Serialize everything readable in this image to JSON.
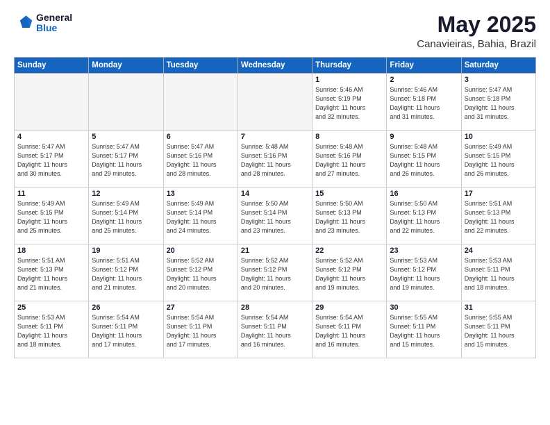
{
  "logo": {
    "general": "General",
    "blue": "Blue"
  },
  "header": {
    "month_year": "May 2025",
    "location": "Canavieiras, Bahia, Brazil"
  },
  "weekdays": [
    "Sunday",
    "Monday",
    "Tuesday",
    "Wednesday",
    "Thursday",
    "Friday",
    "Saturday"
  ],
  "weeks": [
    [
      {
        "day": "",
        "empty": true,
        "content": ""
      },
      {
        "day": "",
        "empty": true,
        "content": ""
      },
      {
        "day": "",
        "empty": true,
        "content": ""
      },
      {
        "day": "",
        "empty": true,
        "content": ""
      },
      {
        "day": "1",
        "empty": false,
        "content": "Sunrise: 5:46 AM\nSunset: 5:19 PM\nDaylight: 11 hours\nand 32 minutes."
      },
      {
        "day": "2",
        "empty": false,
        "content": "Sunrise: 5:46 AM\nSunset: 5:18 PM\nDaylight: 11 hours\nand 31 minutes."
      },
      {
        "day": "3",
        "empty": false,
        "content": "Sunrise: 5:47 AM\nSunset: 5:18 PM\nDaylight: 11 hours\nand 31 minutes."
      }
    ],
    [
      {
        "day": "4",
        "empty": false,
        "content": "Sunrise: 5:47 AM\nSunset: 5:17 PM\nDaylight: 11 hours\nand 30 minutes."
      },
      {
        "day": "5",
        "empty": false,
        "content": "Sunrise: 5:47 AM\nSunset: 5:17 PM\nDaylight: 11 hours\nand 29 minutes."
      },
      {
        "day": "6",
        "empty": false,
        "content": "Sunrise: 5:47 AM\nSunset: 5:16 PM\nDaylight: 11 hours\nand 28 minutes."
      },
      {
        "day": "7",
        "empty": false,
        "content": "Sunrise: 5:48 AM\nSunset: 5:16 PM\nDaylight: 11 hours\nand 28 minutes."
      },
      {
        "day": "8",
        "empty": false,
        "content": "Sunrise: 5:48 AM\nSunset: 5:16 PM\nDaylight: 11 hours\nand 27 minutes."
      },
      {
        "day": "9",
        "empty": false,
        "content": "Sunrise: 5:48 AM\nSunset: 5:15 PM\nDaylight: 11 hours\nand 26 minutes."
      },
      {
        "day": "10",
        "empty": false,
        "content": "Sunrise: 5:49 AM\nSunset: 5:15 PM\nDaylight: 11 hours\nand 26 minutes."
      }
    ],
    [
      {
        "day": "11",
        "empty": false,
        "content": "Sunrise: 5:49 AM\nSunset: 5:15 PM\nDaylight: 11 hours\nand 25 minutes."
      },
      {
        "day": "12",
        "empty": false,
        "content": "Sunrise: 5:49 AM\nSunset: 5:14 PM\nDaylight: 11 hours\nand 25 minutes."
      },
      {
        "day": "13",
        "empty": false,
        "content": "Sunrise: 5:49 AM\nSunset: 5:14 PM\nDaylight: 11 hours\nand 24 minutes."
      },
      {
        "day": "14",
        "empty": false,
        "content": "Sunrise: 5:50 AM\nSunset: 5:14 PM\nDaylight: 11 hours\nand 23 minutes."
      },
      {
        "day": "15",
        "empty": false,
        "content": "Sunrise: 5:50 AM\nSunset: 5:13 PM\nDaylight: 11 hours\nand 23 minutes."
      },
      {
        "day": "16",
        "empty": false,
        "content": "Sunrise: 5:50 AM\nSunset: 5:13 PM\nDaylight: 11 hours\nand 22 minutes."
      },
      {
        "day": "17",
        "empty": false,
        "content": "Sunrise: 5:51 AM\nSunset: 5:13 PM\nDaylight: 11 hours\nand 22 minutes."
      }
    ],
    [
      {
        "day": "18",
        "empty": false,
        "content": "Sunrise: 5:51 AM\nSunset: 5:13 PM\nDaylight: 11 hours\nand 21 minutes."
      },
      {
        "day": "19",
        "empty": false,
        "content": "Sunrise: 5:51 AM\nSunset: 5:12 PM\nDaylight: 11 hours\nand 21 minutes."
      },
      {
        "day": "20",
        "empty": false,
        "content": "Sunrise: 5:52 AM\nSunset: 5:12 PM\nDaylight: 11 hours\nand 20 minutes."
      },
      {
        "day": "21",
        "empty": false,
        "content": "Sunrise: 5:52 AM\nSunset: 5:12 PM\nDaylight: 11 hours\nand 20 minutes."
      },
      {
        "day": "22",
        "empty": false,
        "content": "Sunrise: 5:52 AM\nSunset: 5:12 PM\nDaylight: 11 hours\nand 19 minutes."
      },
      {
        "day": "23",
        "empty": false,
        "content": "Sunrise: 5:53 AM\nSunset: 5:12 PM\nDaylight: 11 hours\nand 19 minutes."
      },
      {
        "day": "24",
        "empty": false,
        "content": "Sunrise: 5:53 AM\nSunset: 5:11 PM\nDaylight: 11 hours\nand 18 minutes."
      }
    ],
    [
      {
        "day": "25",
        "empty": false,
        "content": "Sunrise: 5:53 AM\nSunset: 5:11 PM\nDaylight: 11 hours\nand 18 minutes."
      },
      {
        "day": "26",
        "empty": false,
        "content": "Sunrise: 5:54 AM\nSunset: 5:11 PM\nDaylight: 11 hours\nand 17 minutes."
      },
      {
        "day": "27",
        "empty": false,
        "content": "Sunrise: 5:54 AM\nSunset: 5:11 PM\nDaylight: 11 hours\nand 17 minutes."
      },
      {
        "day": "28",
        "empty": false,
        "content": "Sunrise: 5:54 AM\nSunset: 5:11 PM\nDaylight: 11 hours\nand 16 minutes."
      },
      {
        "day": "29",
        "empty": false,
        "content": "Sunrise: 5:54 AM\nSunset: 5:11 PM\nDaylight: 11 hours\nand 16 minutes."
      },
      {
        "day": "30",
        "empty": false,
        "content": "Sunrise: 5:55 AM\nSunset: 5:11 PM\nDaylight: 11 hours\nand 15 minutes."
      },
      {
        "day": "31",
        "empty": false,
        "content": "Sunrise: 5:55 AM\nSunset: 5:11 PM\nDaylight: 11 hours\nand 15 minutes."
      }
    ]
  ]
}
